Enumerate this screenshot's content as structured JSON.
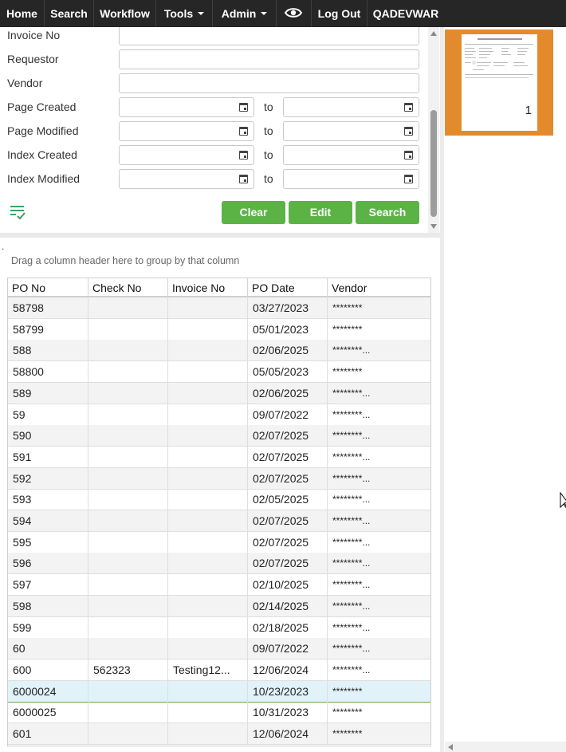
{
  "nav": {
    "items": [
      {
        "label": "Home"
      },
      {
        "label": "Search"
      },
      {
        "label": "Workflow"
      },
      {
        "label": "Tools"
      },
      {
        "label": "Admin"
      },
      {
        "label": "Log Out"
      },
      {
        "label": "QADEVWAR"
      }
    ],
    "eye_icon": "eye-icon"
  },
  "search_form": {
    "fields": {
      "invoice_no": {
        "label": "Invoice No",
        "value": ""
      },
      "requestor": {
        "label": "Requestor",
        "value": ""
      },
      "vendor": {
        "label": "Vendor",
        "value": ""
      }
    },
    "date_fields": [
      {
        "label": "Page Created",
        "from": "",
        "to": ""
      },
      {
        "label": "Page Modified",
        "from": "",
        "to": ""
      },
      {
        "label": "Index Created",
        "from": "",
        "to": ""
      },
      {
        "label": "Index Modified",
        "from": "",
        "to": ""
      }
    ],
    "to_label": "to",
    "buttons": {
      "clear": "Clear",
      "edit": "Edit",
      "search": "Search"
    },
    "button_color": "#5bb346"
  },
  "stray_text": ".",
  "grid": {
    "group_hint": "Drag a column header here to group by that column",
    "columns": [
      "PO No",
      "Check No",
      "Invoice No",
      "PO Date",
      "Vendor"
    ],
    "rows": [
      {
        "po_no": "58798",
        "check_no": "",
        "invoice_no": "",
        "po_date": "03/27/2023",
        "vendor": "********"
      },
      {
        "po_no": "58799",
        "check_no": "",
        "invoice_no": "",
        "po_date": "05/01/2023",
        "vendor": "********"
      },
      {
        "po_no": "588",
        "check_no": "",
        "invoice_no": "",
        "po_date": "02/06/2025",
        "vendor": "********..."
      },
      {
        "po_no": "58800",
        "check_no": "",
        "invoice_no": "",
        "po_date": "05/05/2023",
        "vendor": "********"
      },
      {
        "po_no": "589",
        "check_no": "",
        "invoice_no": "",
        "po_date": "02/06/2025",
        "vendor": "********..."
      },
      {
        "po_no": "59",
        "check_no": "",
        "invoice_no": "",
        "po_date": "09/07/2022",
        "vendor": "********..."
      },
      {
        "po_no": "590",
        "check_no": "",
        "invoice_no": "",
        "po_date": "02/07/2025",
        "vendor": "********..."
      },
      {
        "po_no": "591",
        "check_no": "",
        "invoice_no": "",
        "po_date": "02/07/2025",
        "vendor": "********..."
      },
      {
        "po_no": "592",
        "check_no": "",
        "invoice_no": "",
        "po_date": "02/07/2025",
        "vendor": "********..."
      },
      {
        "po_no": "593",
        "check_no": "",
        "invoice_no": "",
        "po_date": "02/05/2025",
        "vendor": "********..."
      },
      {
        "po_no": "594",
        "check_no": "",
        "invoice_no": "",
        "po_date": "02/07/2025",
        "vendor": "********..."
      },
      {
        "po_no": "595",
        "check_no": "",
        "invoice_no": "",
        "po_date": "02/07/2025",
        "vendor": "********..."
      },
      {
        "po_no": "596",
        "check_no": "",
        "invoice_no": "",
        "po_date": "02/07/2025",
        "vendor": "********..."
      },
      {
        "po_no": "597",
        "check_no": "",
        "invoice_no": "",
        "po_date": "02/10/2025",
        "vendor": "********..."
      },
      {
        "po_no": "598",
        "check_no": "",
        "invoice_no": "",
        "po_date": "02/14/2025",
        "vendor": "********..."
      },
      {
        "po_no": "599",
        "check_no": "",
        "invoice_no": "",
        "po_date": "02/18/2025",
        "vendor": "********..."
      },
      {
        "po_no": "60",
        "check_no": "",
        "invoice_no": "",
        "po_date": "09/07/2022",
        "vendor": "********..."
      },
      {
        "po_no": "600",
        "check_no": "562323",
        "invoice_no": "Testing12...",
        "po_date": "12/06/2024",
        "vendor": "********..."
      },
      {
        "po_no": "6000024",
        "check_no": "",
        "invoice_no": "",
        "po_date": "10/23/2023",
        "vendor": "********",
        "selected": true
      },
      {
        "po_no": "6000025",
        "check_no": "",
        "invoice_no": "",
        "po_date": "10/31/2023",
        "vendor": "********"
      },
      {
        "po_no": "601",
        "check_no": "",
        "invoice_no": "",
        "po_date": "12/06/2024",
        "vendor": "********"
      }
    ]
  },
  "thumbnail": {
    "page_number": "1",
    "frame_color": "#e38b2c"
  }
}
